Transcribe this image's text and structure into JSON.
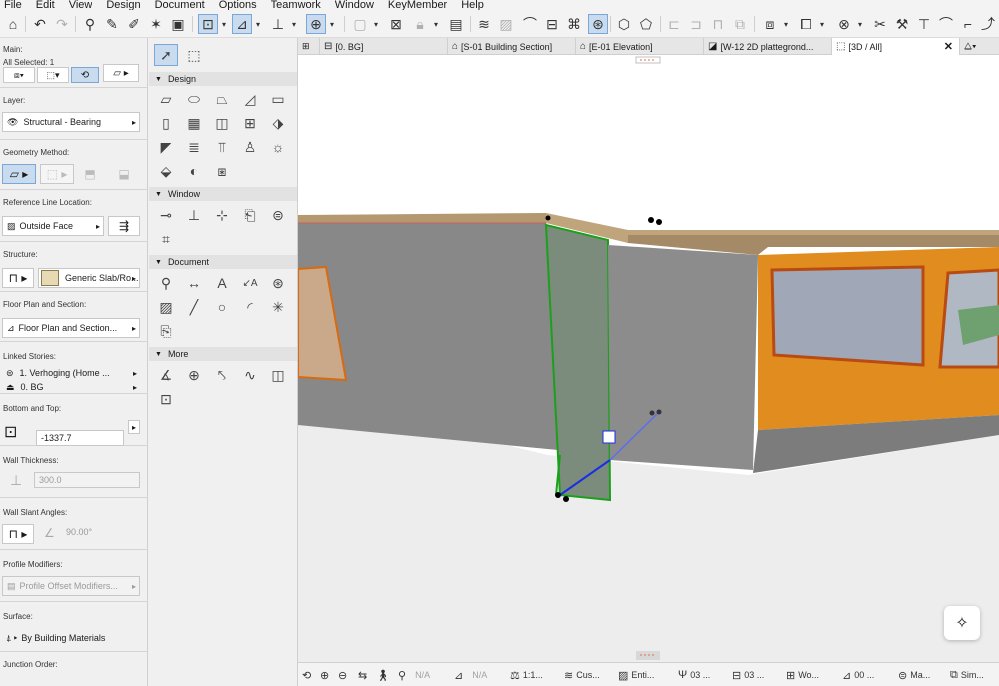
{
  "menu": [
    "File",
    "Edit",
    "View",
    "Design",
    "Document",
    "Options",
    "Teamwork",
    "Window",
    "KeyMember",
    "Help"
  ],
  "infobox": {
    "main_label": "Main:",
    "all_selected": "All Selected: 1",
    "layer_label": "Layer:",
    "layer_value": "Structural - Bearing",
    "geometry_label": "Geometry Method:",
    "refline_label": "Reference Line Location:",
    "refline_value": "Outside Face",
    "structure_label": "Structure:",
    "structure_value": "Generic Slab/Ro...",
    "floorplan_label": "Floor Plan and Section:",
    "floorplan_value": "Floor Plan and Section...",
    "linked_label": "Linked Stories:",
    "linked_top": "1. Verhoging (Home ...",
    "linked_bottom": "0. BG",
    "bottomtop_label": "Bottom and Top:",
    "bottom_value": "-1337.7",
    "thickness_label": "Wall Thickness:",
    "thickness_value": "300.0",
    "slant_label": "Wall Slant Angles:",
    "slant_value": "90.00°",
    "profile_label": "Profile Modifiers:",
    "profile_value": "Profile Offset Modifiers...",
    "surface_label": "Surface:",
    "surface_value": "By Building Materials",
    "junction_label": "Junction Order:"
  },
  "toolbox": {
    "design": "Design",
    "window": "Window",
    "document": "Document",
    "more": "More"
  },
  "tabs": [
    {
      "label": "[0. BG]",
      "icon": "floorplan-icon"
    },
    {
      "label": "[S-01 Building Section]",
      "icon": "section-icon"
    },
    {
      "label": "[E-01 Elevation]",
      "icon": "elevation-icon"
    },
    {
      "label": "[W-12 2D plattegrond...",
      "icon": "worksheet-icon"
    },
    {
      "label": "[3D / All]",
      "icon": "3d-icon"
    }
  ],
  "tab_overflow": "Sim...",
  "status": {
    "na1": "N/A",
    "na2": "N/A",
    "scale": "1:1...",
    "layer_combo": "Cus...",
    "model_view": "Enti...",
    "story1": "03 ...",
    "story2": "03 ...",
    "display": "Wo...",
    "pen": "00 ...",
    "renov": "Ma...",
    "sim": "Sim..."
  },
  "colors": {
    "selection": "#c9dcef",
    "wall_grey": "#8c8c8c",
    "wall_orange": "#e08c1e",
    "highlight_green": "#1aa01a",
    "axis_blue": "#1a2ee6"
  }
}
